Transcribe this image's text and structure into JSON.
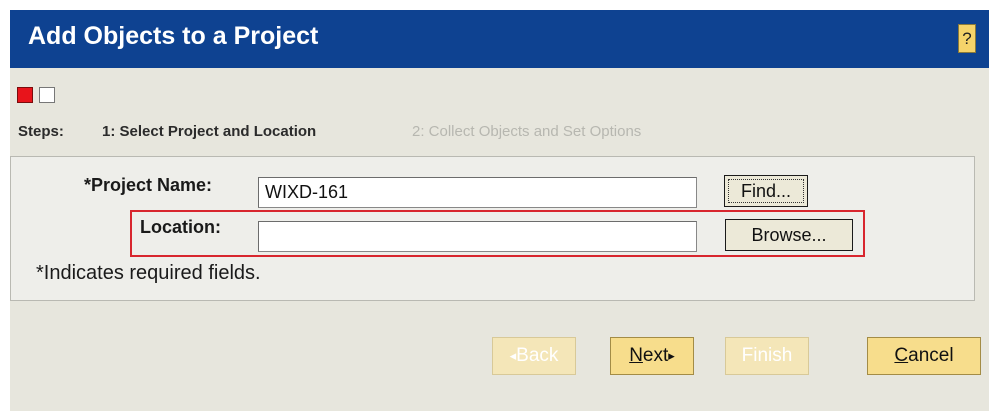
{
  "dialog": {
    "title": "Add Objects to a Project",
    "help_label": "?"
  },
  "steps": {
    "label": "Steps:",
    "step1": "1: Select Project and Location",
    "step2": "2: Collect Objects and Set Options",
    "current_step": 1,
    "total_steps": 2
  },
  "form": {
    "project_name_label": "*Project Name:",
    "project_name_value": "WIXD-161",
    "location_label": "Location:",
    "location_value": "",
    "find_label": "Find...",
    "browse_label": "Browse...",
    "required_note": "*Indicates required fields."
  },
  "nav": {
    "back_prefix": "◂",
    "back_label": "Back",
    "next_label": "Next",
    "next_suffix": "▸",
    "finish_label": "Finish",
    "cancel_label": "Cancel",
    "back_enabled": false,
    "next_enabled": true,
    "finish_enabled": false,
    "cancel_enabled": true
  },
  "colors": {
    "title_bar": "#0e4291",
    "body_background": "#e7e6dd",
    "active_step": "#e8141b",
    "highlight_outline": "#d8262e",
    "nav_button": "#f7dd8c"
  }
}
